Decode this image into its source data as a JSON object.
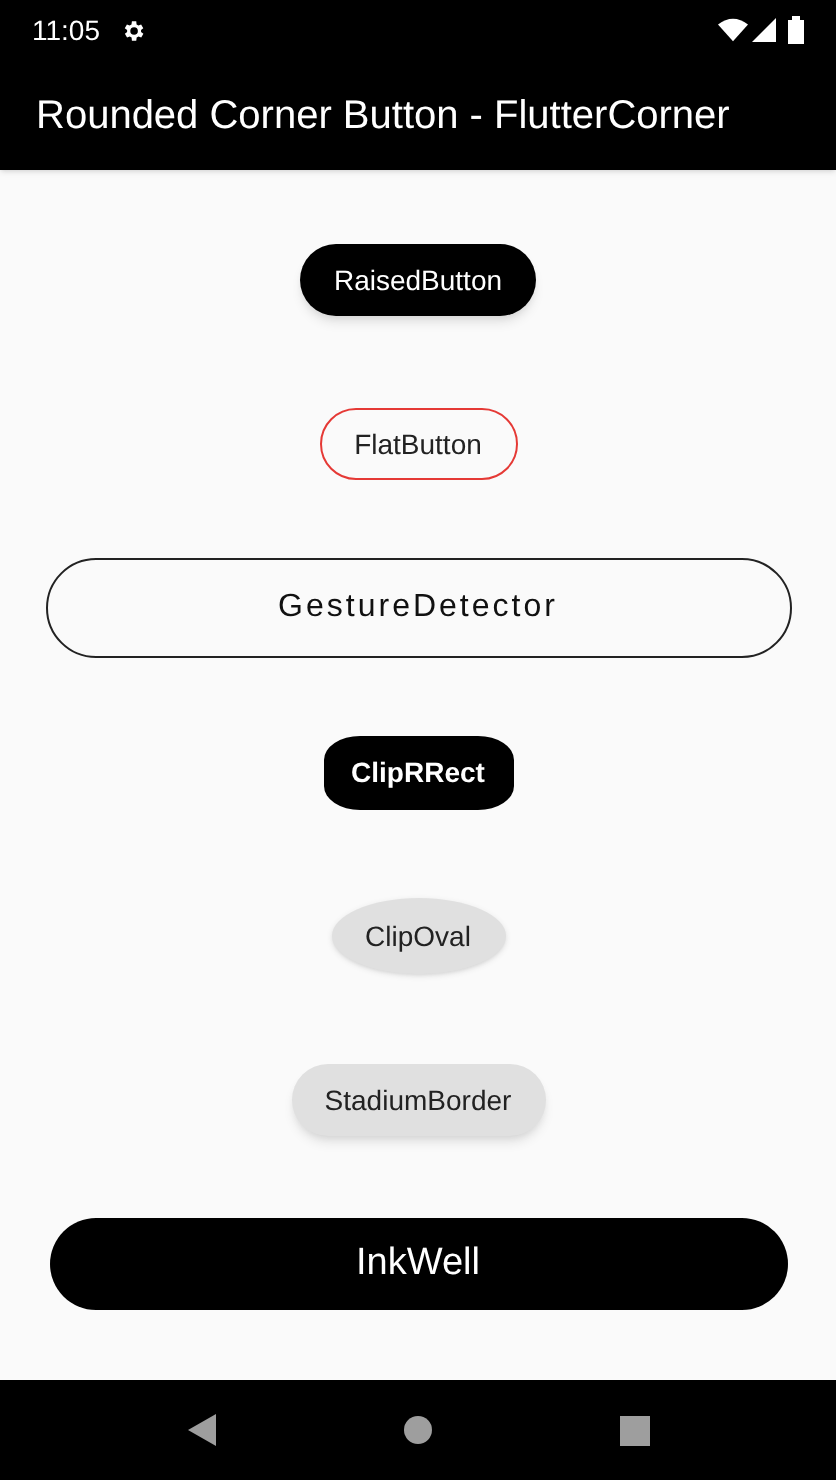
{
  "status_bar": {
    "time": "11:05"
  },
  "app_bar": {
    "title": "Rounded Corner Button - FlutterCorner"
  },
  "buttons": [
    {
      "kind": "raised",
      "label": "RaisedButton"
    },
    {
      "kind": "flat",
      "label": "FlatButton"
    },
    {
      "kind": "gesture",
      "label": "GestureDetector"
    },
    {
      "kind": "cliprrect",
      "label": "ClipRRect"
    },
    {
      "kind": "clipoval",
      "label": "ClipOval"
    },
    {
      "kind": "stadium",
      "label": "StadiumBorder"
    },
    {
      "kind": "inkwell",
      "label": "InkWell"
    }
  ]
}
